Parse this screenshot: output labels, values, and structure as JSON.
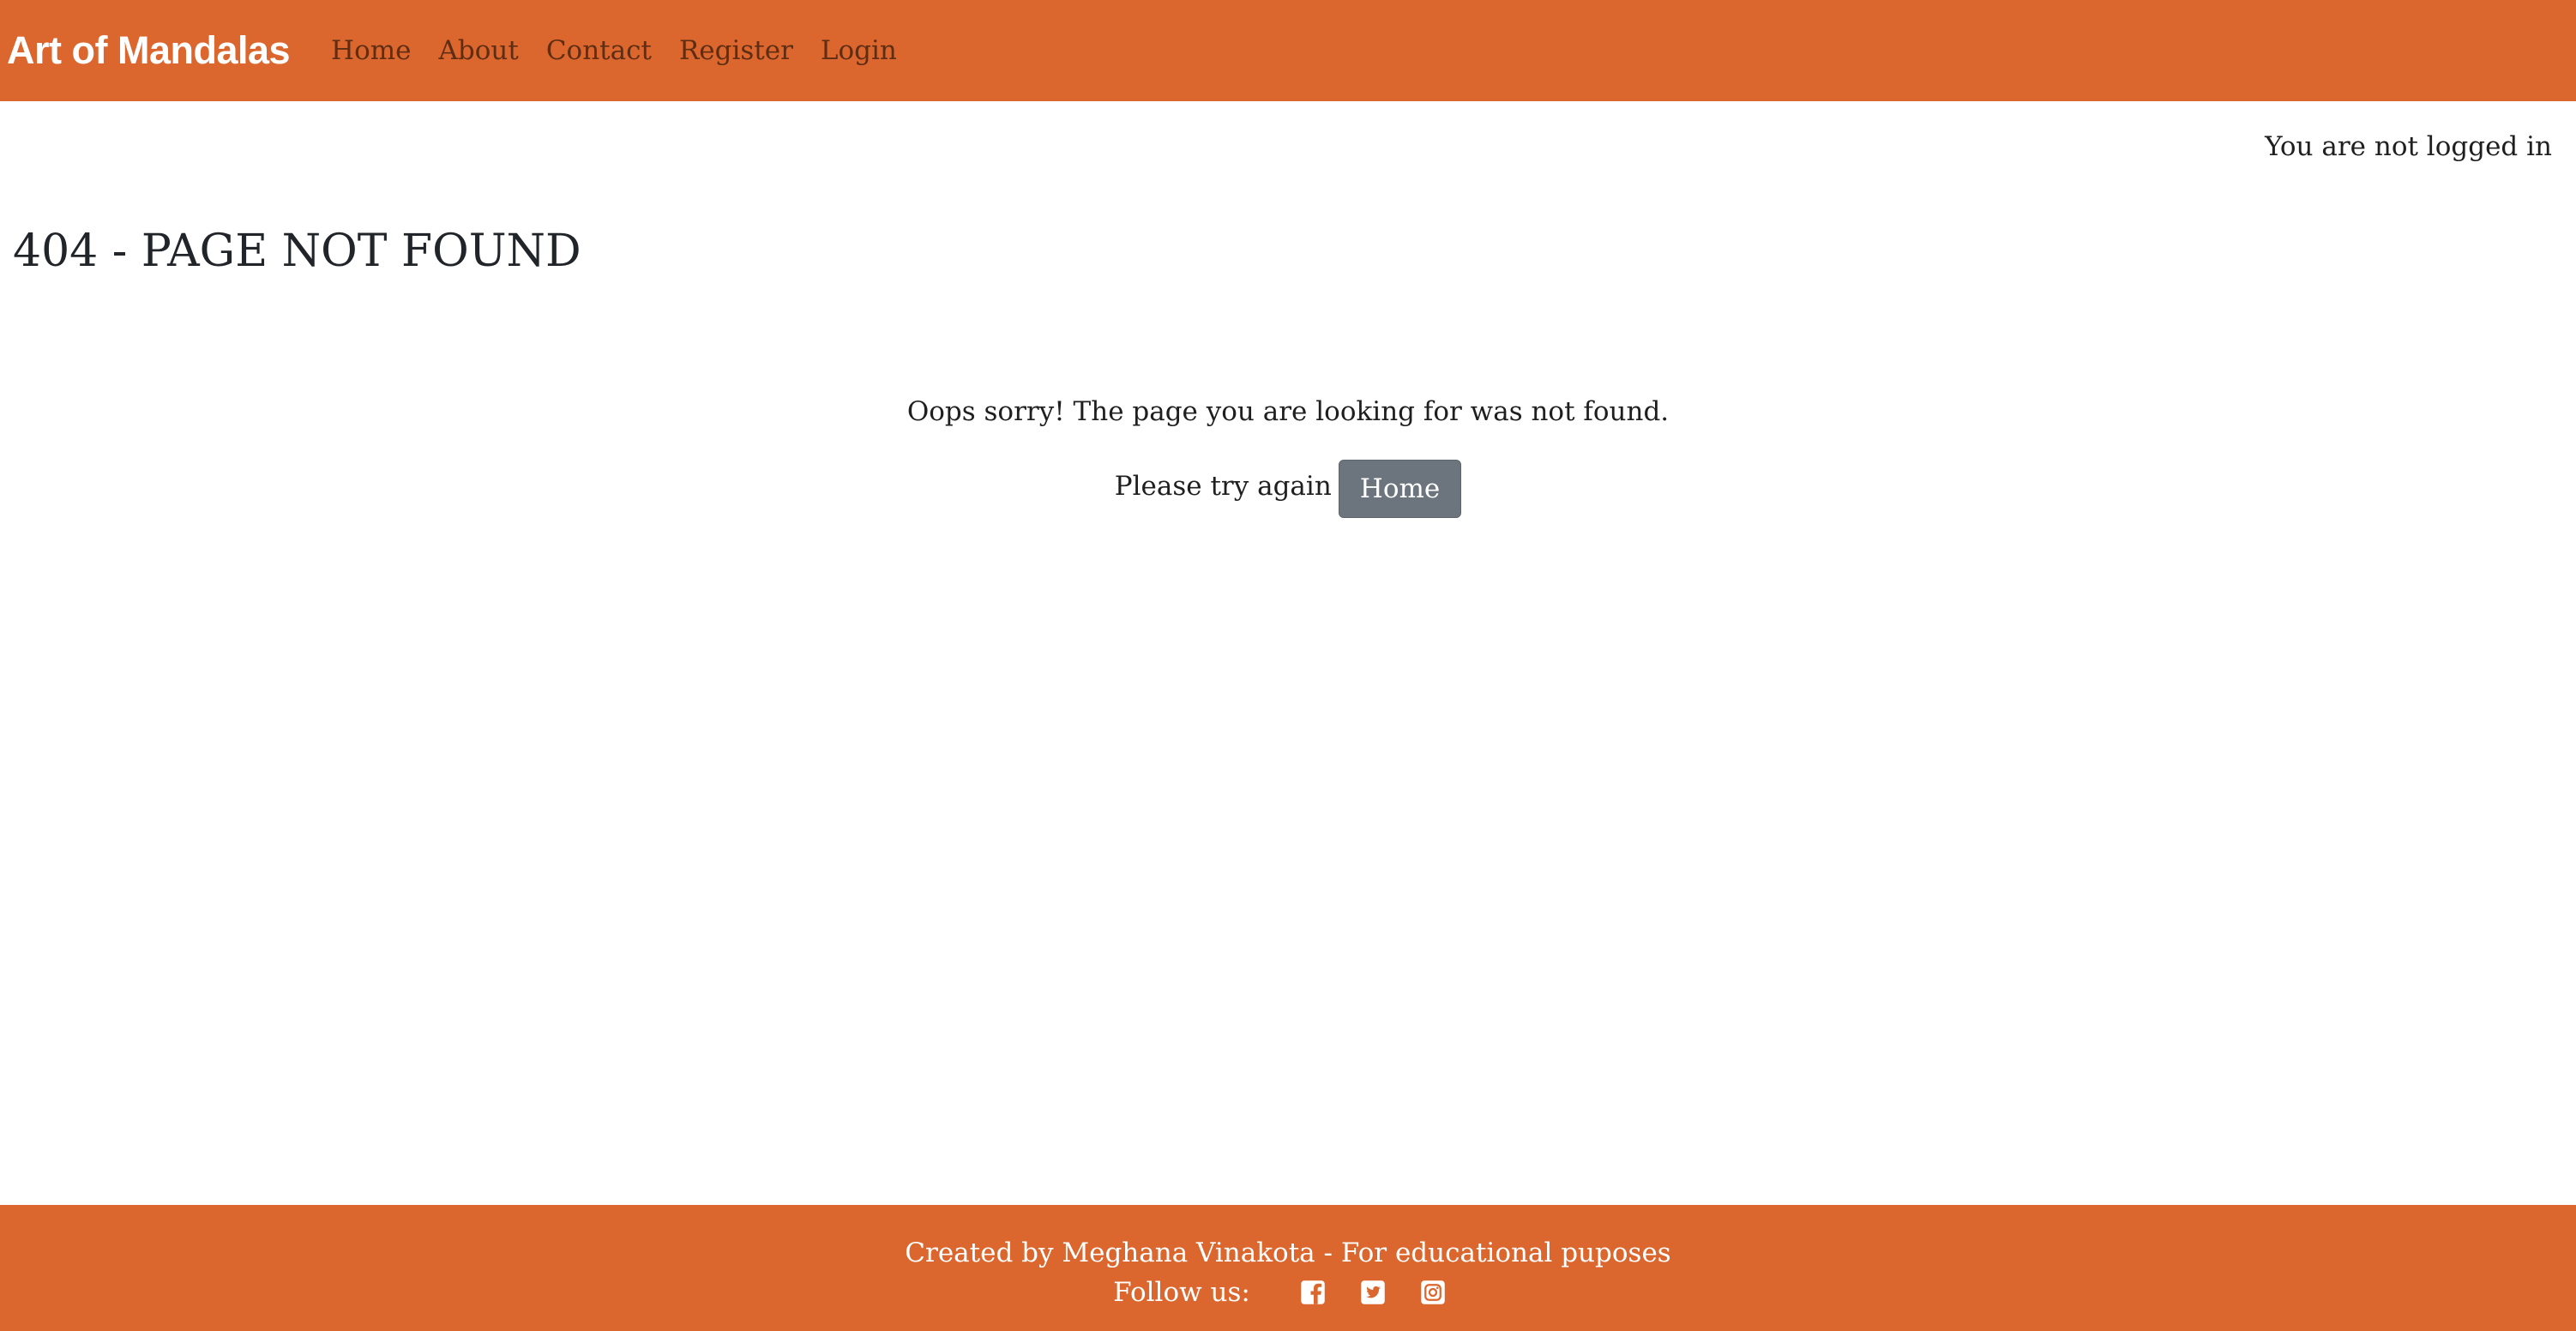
{
  "header": {
    "brand": "Art of Mandalas",
    "nav": [
      "Home",
      "About",
      "Contact",
      "Register",
      "Login"
    ]
  },
  "status": {
    "login_text": "You are not logged in"
  },
  "main": {
    "title": "404 - PAGE NOT FOUND",
    "message": "Oops sorry! The page you are looking for was not found.",
    "retry_text": "Please try again",
    "home_button": "Home"
  },
  "footer": {
    "credit": "Created by Meghana Vinakota - For educational puposes",
    "follow_label": "Follow us:",
    "social": [
      "facebook-icon",
      "twitter-icon",
      "instagram-icon"
    ]
  },
  "colors": {
    "brand_orange": "#db672e",
    "nav_link": "#5e2d13",
    "button_gray": "#6c757d",
    "white": "#ffffff"
  }
}
